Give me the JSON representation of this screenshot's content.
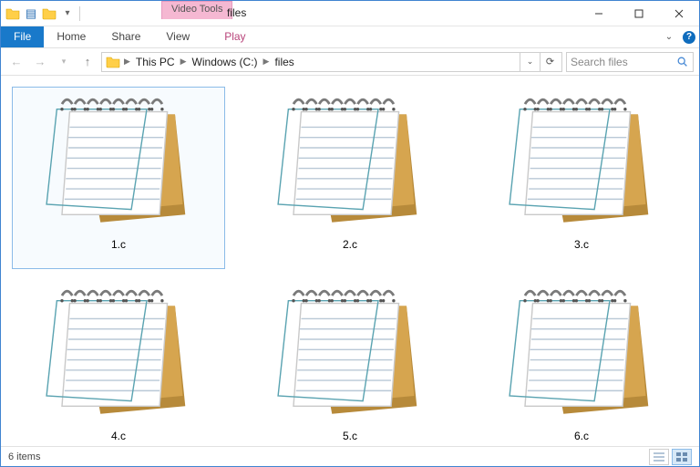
{
  "window": {
    "title": "files",
    "context_tab_header": "Video Tools"
  },
  "ribbon": {
    "file": "File",
    "tabs": [
      "Home",
      "Share",
      "View"
    ],
    "context_tab": "Play"
  },
  "breadcrumb": {
    "segments": [
      "This PC",
      "Windows (C:)",
      "files"
    ]
  },
  "search": {
    "placeholder": "Search files"
  },
  "files": [
    {
      "name": "1.c",
      "selected": true
    },
    {
      "name": "2.c",
      "selected": false
    },
    {
      "name": "3.c",
      "selected": false
    },
    {
      "name": "4.c",
      "selected": false
    },
    {
      "name": "5.c",
      "selected": false
    },
    {
      "name": "6.c",
      "selected": false
    }
  ],
  "status": {
    "count_text": "6 items"
  }
}
